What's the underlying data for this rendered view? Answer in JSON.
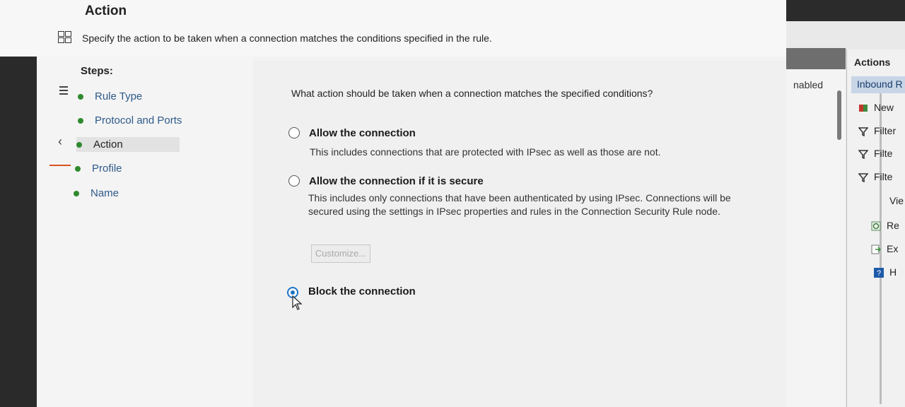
{
  "header": {
    "title": "Action",
    "description": "Specify the action to be taken when a connection matches the conditions specified in the rule."
  },
  "steps": {
    "heading": "Steps:",
    "items": [
      {
        "label": "Rule Type"
      },
      {
        "label": "Protocol and Ports"
      },
      {
        "label": "Action",
        "current": true
      },
      {
        "label": "Profile"
      },
      {
        "label": "Name"
      }
    ]
  },
  "main": {
    "question": "What action should be taken when a connection matches the specified conditions?",
    "options": [
      {
        "label": "Allow the connection",
        "description": "This includes connections that are protected with IPsec as well as those are not.",
        "selected": false
      },
      {
        "label": "Allow the connection if it is secure",
        "description": "This includes only connections that have been authenticated by using IPsec.  Connections will be secured using the settings in IPsec properties and rules in the Connection Security Rule node.",
        "selected": false
      },
      {
        "label": "Block the connection",
        "selected": true
      }
    ],
    "customize_label": "Customize..."
  },
  "background": {
    "enabled_col": "nabled",
    "actions_title": "Actions",
    "actions_sub": "Inbound R",
    "action_items": [
      {
        "label": "New",
        "icon": "new-rule-icon"
      },
      {
        "label": "Filter",
        "icon": "filter-icon"
      },
      {
        "label": "Filte",
        "icon": "filter-icon"
      },
      {
        "label": "Filte",
        "icon": "filter-icon"
      },
      {
        "label": "Vie",
        "icon": "view-icon"
      },
      {
        "label": "Re",
        "icon": "refresh-icon"
      },
      {
        "label": "Ex",
        "icon": "export-icon"
      },
      {
        "label": "H",
        "icon": "help-icon"
      }
    ]
  },
  "colors": {
    "accent": "#1e73c8",
    "step_done_dot": "#2e8a2e",
    "step_link": "#2e5a8a",
    "actions_header_bg": "#c7d5e6"
  }
}
